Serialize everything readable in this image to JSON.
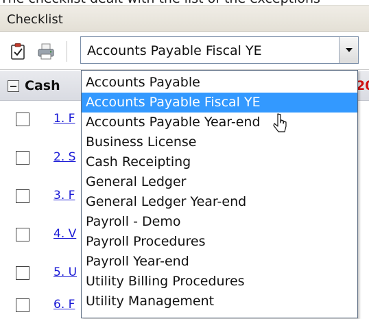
{
  "window": {
    "top_cut_text": "The checklist dealt with the list of the exceptions",
    "panel_title": "Checklist"
  },
  "toolbar": {
    "icons": [
      "checklist-icon",
      "print-icon"
    ],
    "combo_value": "Accounts Payable Fiscal YE"
  },
  "group": {
    "title": "Cash",
    "year": "20"
  },
  "rows": [
    {
      "link": "1. F"
    },
    {
      "link": "2. S"
    },
    {
      "link": "3. F"
    },
    {
      "link": "4. V"
    },
    {
      "link": "5. U"
    },
    {
      "link": "6. F"
    }
  ],
  "dropdown": {
    "options": [
      "Accounts Payable",
      "Accounts Payable Fiscal YE",
      "Accounts Payable Year-end",
      "Business License",
      "Cash Receipting",
      "General Ledger",
      "General Ledger Year-end",
      "Payroll - Demo",
      "Payroll Procedures",
      "Payroll Year-end",
      "Utility Billing Procedures",
      "Utility Management"
    ],
    "selected_index": 1
  },
  "colors": {
    "selection": "#3399ff",
    "link": "#1a1ad6",
    "year_text": "#d01010"
  }
}
